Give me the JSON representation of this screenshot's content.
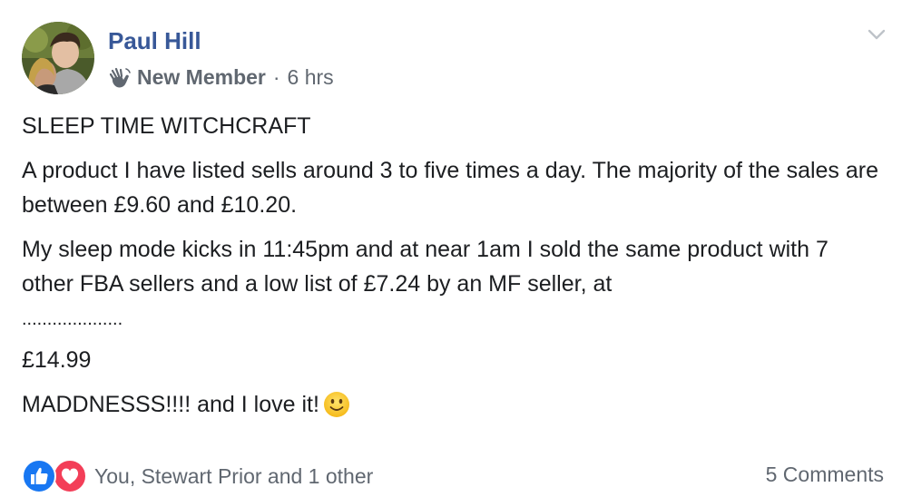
{
  "post": {
    "author": "Paul Hill",
    "badge": "New Member",
    "separator": "·",
    "time": "6 hrs",
    "paragraphs": {
      "title": "SLEEP TIME WITCHCRAFT",
      "p1": "A product I have listed sells around 3 to five times a day. The majority of the sales are between £9.60 and £10.20.",
      "p2": "My sleep mode kicks in 11:45pm and at near 1am I sold the same product with 7 other FBA sellers and a low list of £7.24 by an MF seller, at",
      "dots": "....................",
      "price": "£14.99",
      "closing": "MADDNESSS!!!! and I love it!"
    },
    "reactions_text": "You, Stewart Prior and 1 other",
    "comments_text": "5 Comments"
  },
  "icons": {
    "avatar": "profile-photo",
    "badge_icon": "waving-hand-icon",
    "menu": "chevron-down-icon",
    "emoji": "slightly-smiling-face-icon",
    "reaction_1": "like-icon",
    "reaction_2": "love-icon"
  },
  "colors": {
    "author_link": "#385898",
    "meta_text": "#606770",
    "body_text": "#1c1e21",
    "like_blue": "#1877f2",
    "love_red": "#f33e58"
  }
}
